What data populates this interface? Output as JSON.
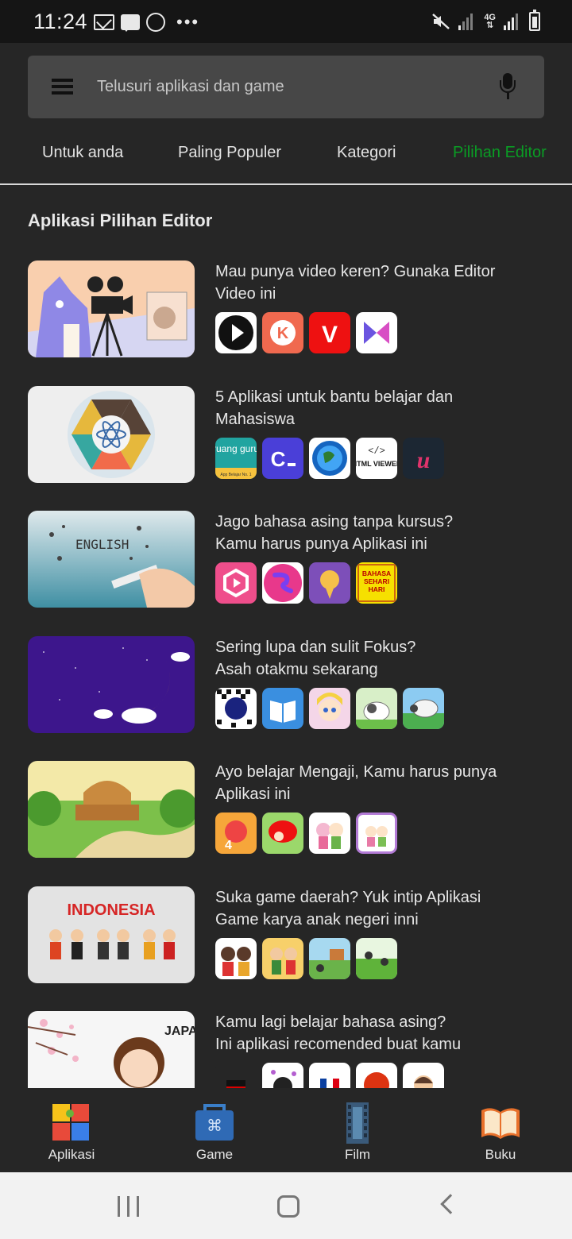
{
  "status_bar": {
    "time": "11:24",
    "network": "4G",
    "icons": [
      "mail-icon",
      "chat-icon",
      "whatsapp-icon",
      "more-dots-icon",
      "mute-icon",
      "signal-icon",
      "signal-icon",
      "battery-icon"
    ]
  },
  "search": {
    "placeholder": "Telusuri aplikasi dan game",
    "menu_icon": "menu-icon",
    "mic_icon": "mic-icon"
  },
  "tabs": [
    {
      "label": "Untuk anda",
      "active": false
    },
    {
      "label": "Paling Populer",
      "active": false
    },
    {
      "label": "Kategori",
      "active": false
    },
    {
      "label": "Pilihan Editor",
      "active": true
    }
  ],
  "colors": {
    "accent": "#0a9c24",
    "background": "#262626",
    "search_bg": "#474747"
  },
  "section": {
    "title": "Aplikasi Pilihan Editor"
  },
  "collections": [
    {
      "title": "Mau punya video keren? Gunaka Editor\nVideo ini",
      "thumb": "cat-with-movie-camera",
      "apps": 4
    },
    {
      "title": "5 Aplikasi untuk bantu belajar dan\nMahasiswa",
      "thumb": "science-hexagon-wheel",
      "apps": 5,
      "app_texts": [
        "ruang guru",
        "App Belajar No. 1",
        "HTML VIEWER"
      ]
    },
    {
      "title": "Jago bahasa asing tanpa kursus?\nKamu harus punya Aplikasi ini",
      "thumb": "english-phone",
      "apps": 4,
      "app_texts": [
        "BAHASA SEHARI HARI"
      ]
    },
    {
      "title": "Sering lupa dan sulit Fokus?\nAsah otakmu sekarang",
      "thumb": "moon-night",
      "apps": 5
    },
    {
      "title": "Ayo belajar Mengaji, Kamu harus punya\nAplikasi ini",
      "thumb": "mosque-landscape",
      "apps": 4
    },
    {
      "title": "Suka game daerah? Yuk intip Aplikasi\nGame karya anak negeri inni",
      "thumb": "indonesia-kids",
      "apps": 4,
      "thumb_text": "INDONESIA"
    },
    {
      "title": "Kamu lagi belajar bahasa asing?\nIni aplikasi recomended buat kamu",
      "thumb": "japan-girl",
      "apps": 5,
      "thumb_text": "JAPAN"
    }
  ],
  "bottom_nav": [
    {
      "label": "Aplikasi",
      "icon": "puzzle-icon"
    },
    {
      "label": "Game",
      "icon": "gamepad-briefcase-icon"
    },
    {
      "label": "Film",
      "icon": "film-strip-icon"
    },
    {
      "label": "Buku",
      "icon": "open-book-icon"
    }
  ],
  "system_nav": [
    "recents-button",
    "home-button",
    "back-button"
  ]
}
